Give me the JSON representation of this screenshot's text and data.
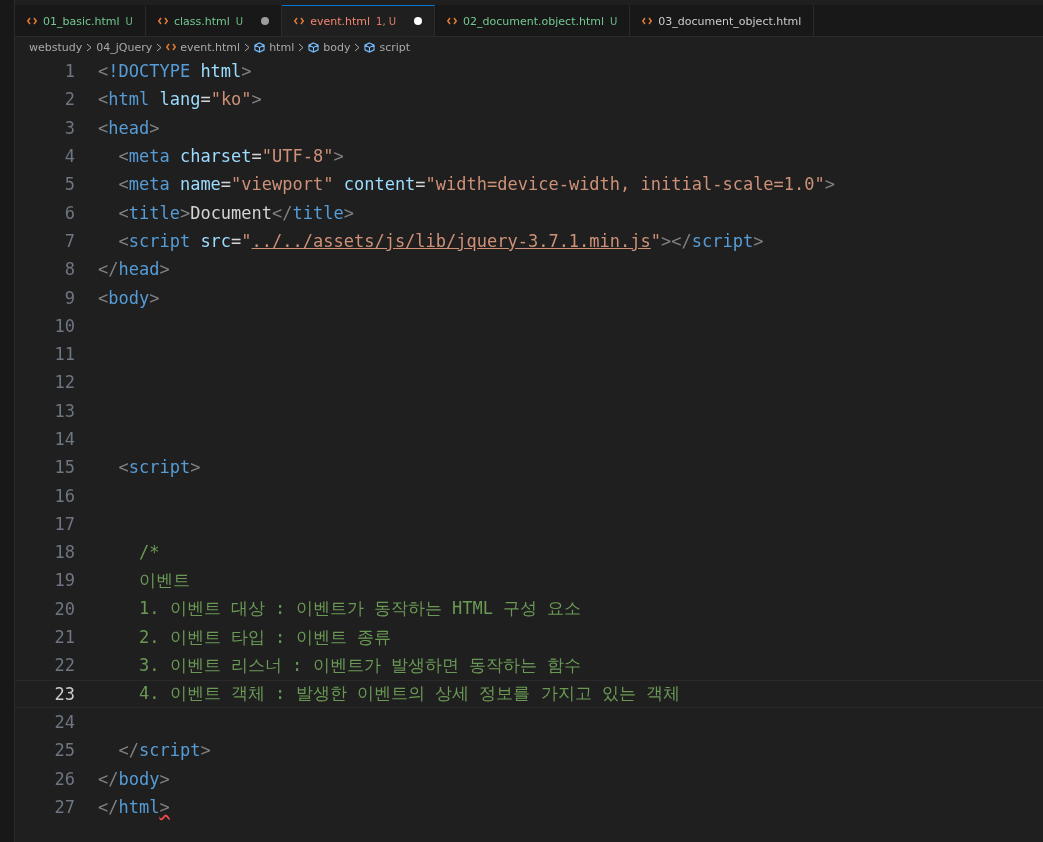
{
  "tabs": [
    {
      "label": "01_basic.html",
      "status": "U",
      "color": "#73c991",
      "dirty": false,
      "selected": false
    },
    {
      "label": "class.html",
      "status": "U",
      "color": "#73c991",
      "dirty": true,
      "selected": false
    },
    {
      "label": "event.html",
      "status": "1, U",
      "color": "#f48771",
      "dirty": true,
      "selected": true
    },
    {
      "label": "02_document.object.html",
      "status": "U",
      "color": "#73c991",
      "dirty": false,
      "selected": false
    },
    {
      "label": "03_document_object.html",
      "color": "#cccccc",
      "dirty": false,
      "selected": false
    }
  ],
  "breadcrumbs": [
    {
      "label": "webstudy",
      "kind": "folder"
    },
    {
      "label": "04_jQuery",
      "kind": "folder"
    },
    {
      "label": "event.html",
      "kind": "file"
    },
    {
      "label": "html",
      "kind": "symbol"
    },
    {
      "label": "body",
      "kind": "symbol"
    },
    {
      "label": "script",
      "kind": "symbol"
    }
  ],
  "lines": [
    {
      "number": "1",
      "current": false,
      "tokens": [
        {
          "kind": "p",
          "text": "<"
        },
        {
          "kind": "t",
          "text": "!DOCTYPE"
        },
        {
          "kind": "a",
          "text": " html"
        },
        {
          "kind": "p",
          "text": ">"
        }
      ]
    },
    {
      "number": "2",
      "current": false,
      "tokens": [
        {
          "kind": "p",
          "text": "<"
        },
        {
          "kind": "t",
          "text": "html"
        },
        {
          "kind": "a",
          "text": " lang"
        },
        {
          "kind": "x",
          "text": "="
        },
        {
          "kind": "s",
          "text": "\"ko\""
        },
        {
          "kind": "p",
          "text": ">"
        }
      ]
    },
    {
      "number": "3",
      "current": false,
      "tokens": [
        {
          "kind": "p",
          "text": "<"
        },
        {
          "kind": "t",
          "text": "head"
        },
        {
          "kind": "p",
          "text": ">"
        }
      ]
    },
    {
      "number": "4",
      "current": false,
      "tokens": [
        {
          "kind": "p",
          "text": "  <"
        },
        {
          "kind": "t",
          "text": "meta"
        },
        {
          "kind": "a",
          "text": " charset"
        },
        {
          "kind": "x",
          "text": "="
        },
        {
          "kind": "s",
          "text": "\"UTF-8\""
        },
        {
          "kind": "p",
          "text": ">"
        }
      ]
    },
    {
      "number": "5",
      "current": false,
      "tokens": [
        {
          "kind": "p",
          "text": "  <"
        },
        {
          "kind": "t",
          "text": "meta"
        },
        {
          "kind": "a",
          "text": " name"
        },
        {
          "kind": "x",
          "text": "="
        },
        {
          "kind": "s",
          "text": "\"viewport\""
        },
        {
          "kind": "a",
          "text": " content"
        },
        {
          "kind": "x",
          "text": "="
        },
        {
          "kind": "s",
          "text": "\"width=device-width, initial-scale=1.0\""
        },
        {
          "kind": "p",
          "text": ">"
        }
      ]
    },
    {
      "number": "6",
      "current": false,
      "tokens": [
        {
          "kind": "p",
          "text": "  <"
        },
        {
          "kind": "t",
          "text": "title"
        },
        {
          "kind": "p",
          "text": ">"
        },
        {
          "kind": "x",
          "text": "Document"
        },
        {
          "kind": "p",
          "text": "</"
        },
        {
          "kind": "t",
          "text": "title"
        },
        {
          "kind": "p",
          "text": ">"
        }
      ]
    },
    {
      "number": "7",
      "current": false,
      "tokens": [
        {
          "kind": "p",
          "text": "  <"
        },
        {
          "kind": "t",
          "text": "script"
        },
        {
          "kind": "a",
          "text": " src"
        },
        {
          "kind": "x",
          "text": "="
        },
        {
          "kind": "s",
          "text": "\""
        },
        {
          "kind": "u",
          "text": "../../assets/js/lib/jquery-3.7.1.min.js"
        },
        {
          "kind": "s",
          "text": "\""
        },
        {
          "kind": "p",
          "text": "></"
        },
        {
          "kind": "t",
          "text": "script"
        },
        {
          "kind": "p",
          "text": ">"
        }
      ]
    },
    {
      "number": "8",
      "current": false,
      "tokens": [
        {
          "kind": "p",
          "text": "</"
        },
        {
          "kind": "t",
          "text": "head"
        },
        {
          "kind": "p",
          "text": ">"
        }
      ]
    },
    {
      "number": "9",
      "current": false,
      "tokens": [
        {
          "kind": "p",
          "text": "<"
        },
        {
          "kind": "t",
          "text": "body"
        },
        {
          "kind": "p",
          "text": ">"
        }
      ]
    },
    {
      "number": "10",
      "current": false
    },
    {
      "number": "11",
      "current": false
    },
    {
      "number": "12",
      "current": false
    },
    {
      "number": "13",
      "current": false
    },
    {
      "number": "14",
      "current": false
    },
    {
      "number": "15",
      "current": false,
      "tokens": [
        {
          "kind": "p",
          "text": "  <"
        },
        {
          "kind": "t",
          "text": "script"
        },
        {
          "kind": "p",
          "text": ">"
        }
      ]
    },
    {
      "number": "16",
      "current": false
    },
    {
      "number": "17",
      "current": false
    },
    {
      "number": "18",
      "current": false,
      "tokens": [
        {
          "kind": "c",
          "text": "    /*"
        }
      ]
    },
    {
      "number": "19",
      "current": false,
      "tokens": [
        {
          "kind": "c",
          "text": "    이벤트"
        }
      ]
    },
    {
      "number": "20",
      "current": false,
      "tokens": [
        {
          "kind": "c",
          "text": "    1. 이벤트 대상 : 이벤트가 동작하는 HTML 구성 요소"
        }
      ]
    },
    {
      "number": "21",
      "current": false,
      "tokens": [
        {
          "kind": "c",
          "text": "    2. 이벤트 타입 : 이벤트 종류"
        }
      ]
    },
    {
      "number": "22",
      "current": false,
      "tokens": [
        {
          "kind": "c",
          "text": "    3. 이벤트 리스너 : 이벤트가 발생하면 동작하는 함수"
        }
      ]
    },
    {
      "number": "23",
      "current": true,
      "tokens": [
        {
          "kind": "c",
          "text": "    4. 이벤트 객체 : 발생한 이벤트의 상세 정보를 가지고 있는 객체"
        }
      ]
    },
    {
      "number": "24",
      "current": false
    },
    {
      "number": "25",
      "current": false,
      "tokens": [
        {
          "kind": "p",
          "text": "  </"
        },
        {
          "kind": "t",
          "text": "script"
        },
        {
          "kind": "p",
          "text": ">"
        }
      ]
    },
    {
      "number": "26",
      "current": false,
      "tokens": [
        {
          "kind": "p",
          "text": "</"
        },
        {
          "kind": "t",
          "text": "body"
        },
        {
          "kind": "p",
          "text": ">"
        }
      ]
    },
    {
      "number": "27",
      "current": false,
      "tokens": [
        {
          "kind": "p",
          "text": "</"
        },
        {
          "kind": "t",
          "text": "html"
        },
        {
          "kind": "p",
          "text": ">",
          "squiggle": true
        }
      ]
    }
  ]
}
